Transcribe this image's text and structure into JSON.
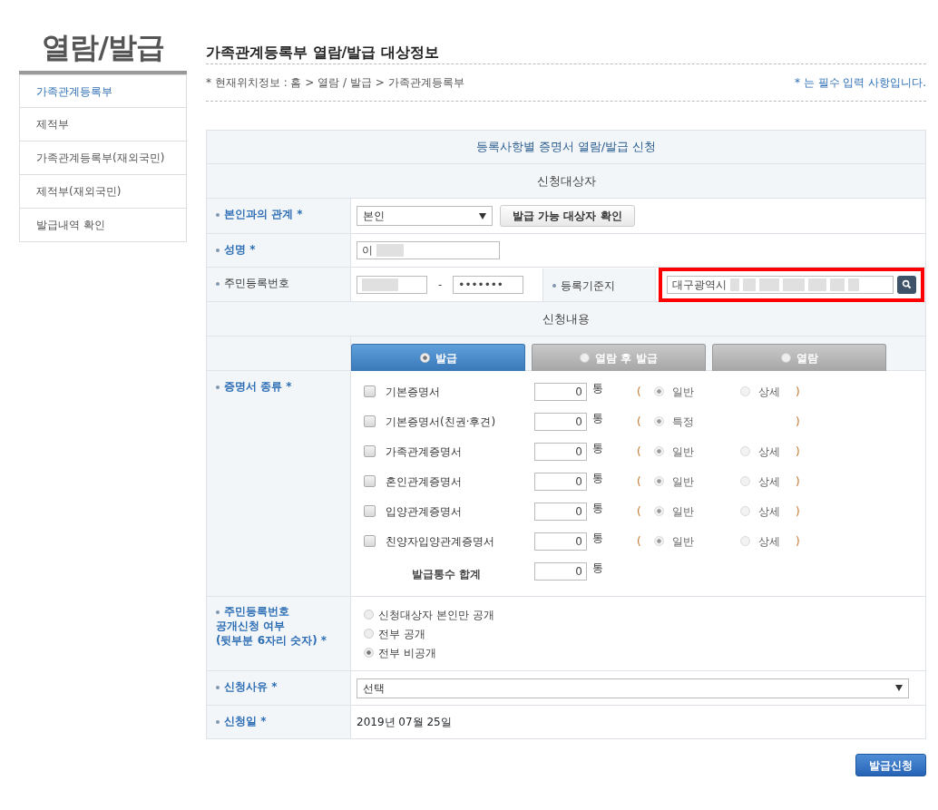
{
  "sidebar": {
    "title": "열람/발급",
    "items": [
      {
        "label": "가족관계등록부",
        "selected": true
      },
      {
        "label": "제적부",
        "selected": false
      },
      {
        "label": "가족관계등록부(재외국민)",
        "selected": false
      },
      {
        "label": "제적부(재외국민)",
        "selected": false
      },
      {
        "label": "발급내역 확인",
        "selected": false
      }
    ]
  },
  "page_title": "가족관계등록부 열람/발급 대상정보",
  "breadcrumb": "* 현재위치정보 : 홈 > 열람 / 발급 > 가족관계등록부",
  "required_note": "* 는 필수 입력 사항입니다.",
  "form": {
    "title": "등록사항별 증명서 열람/발급 신청",
    "applicant_heading": "신청대상자",
    "relation": {
      "label": "본인과의 관계 *",
      "required": true,
      "value": "본인",
      "button": "발급 가능 대상자 확인"
    },
    "name": {
      "label": "성명 *",
      "required": true,
      "value": "이",
      "blurred": true
    },
    "rrn": {
      "label": "주민등록번호",
      "required": false,
      "front_blurred": true,
      "separator": "-",
      "back": "•••••••"
    },
    "registry": {
      "label": "등록기준지",
      "required": false,
      "value": "대구광역시",
      "blurred": true,
      "highlighted": true
    },
    "content_heading": "신청내용",
    "modes": [
      {
        "label": "발급",
        "selected": true
      },
      {
        "label": "열람 후 발급",
        "selected": false
      },
      {
        "label": "열람",
        "selected": false
      }
    ],
    "certificates": {
      "label": "증명서 종류 *",
      "required": true,
      "rows": [
        {
          "name": "기본증명서",
          "checked": false,
          "count": "0",
          "unit": "통",
          "open": "(",
          "options": [
            {
              "label": "일반",
              "selected": true
            },
            {
              "label": "상세",
              "selected": false
            }
          ],
          "close": ")"
        },
        {
          "name": "기본증명서(친권·후견)",
          "checked": false,
          "count": "0",
          "unit": "통",
          "open": "(",
          "options": [
            {
              "label": "특정",
              "selected": true
            }
          ],
          "close": ")"
        },
        {
          "name": "가족관계증명서",
          "checked": false,
          "count": "0",
          "unit": "통",
          "open": "(",
          "options": [
            {
              "label": "일반",
              "selected": true
            },
            {
              "label": "상세",
              "selected": false
            }
          ],
          "close": ")"
        },
        {
          "name": "혼인관계증명서",
          "checked": false,
          "count": "0",
          "unit": "통",
          "open": "(",
          "options": [
            {
              "label": "일반",
              "selected": true
            },
            {
              "label": "상세",
              "selected": false
            }
          ],
          "close": ")"
        },
        {
          "name": "입양관계증명서",
          "checked": false,
          "count": "0",
          "unit": "통",
          "open": "(",
          "options": [
            {
              "label": "일반",
              "selected": true
            },
            {
              "label": "상세",
              "selected": false
            }
          ],
          "close": ")"
        },
        {
          "name": "친양자입양관계증명서",
          "checked": false,
          "count": "0",
          "unit": "통",
          "open": "(",
          "options": [
            {
              "label": "일반",
              "selected": true
            },
            {
              "label": "상세",
              "selected": false
            }
          ],
          "close": ")"
        }
      ],
      "total": {
        "label": "발급통수 합계",
        "count": "0",
        "unit": "통"
      }
    },
    "disclosure": {
      "label_lines": [
        "주민등록번호",
        "공개신청 여부",
        "(뒷부분 6자리 숫자) *"
      ],
      "required": true,
      "options": [
        {
          "label": "신청대상자 본인만 공개",
          "selected": false
        },
        {
          "label": "전부 공개",
          "selected": false
        },
        {
          "label": "전부 비공개",
          "selected": true
        }
      ]
    },
    "reason": {
      "label": "신청사유 *",
      "required": true,
      "value": "선택"
    },
    "date": {
      "label": "신청일 *",
      "required": true,
      "value": "2019년 07월 25일"
    }
  },
  "submit": "발급신청"
}
